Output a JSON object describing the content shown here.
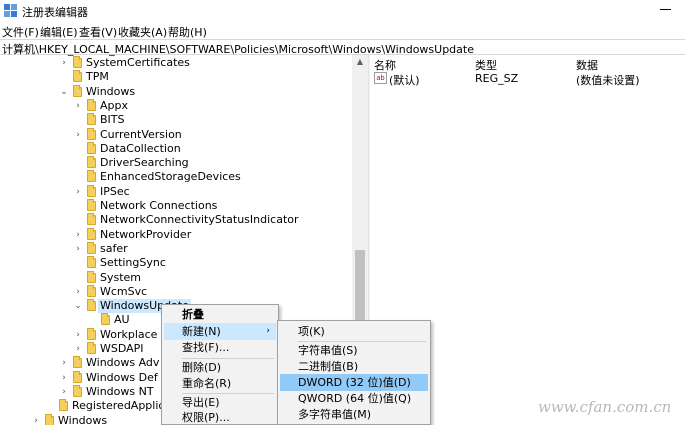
{
  "window": {
    "title": "注册表编辑器",
    "app_icon": "regedit-icon"
  },
  "menu": [
    "文件(F)",
    "编辑(E)",
    "查看(V)",
    "收藏夹(A)",
    "帮助(H)"
  ],
  "address": "计算机\\HKEY_LOCAL_MACHINE\\SOFTWARE\\Policies\\Microsoft\\Windows\\WindowsUpdate",
  "tree": [
    {
      "label": "SystemCertificates",
      "arrow": "›"
    },
    {
      "label": "TPM",
      "arrow": ""
    },
    {
      "label": "Windows",
      "arrow": "⌄"
    },
    {
      "label": "Appx",
      "arrow": "›"
    },
    {
      "label": "BITS",
      "arrow": ""
    },
    {
      "label": "CurrentVersion",
      "arrow": "›"
    },
    {
      "label": "DataCollection",
      "arrow": ""
    },
    {
      "label": "DriverSearching",
      "arrow": ""
    },
    {
      "label": "EnhancedStorageDevices",
      "arrow": ""
    },
    {
      "label": "IPSec",
      "arrow": "›"
    },
    {
      "label": "Network Connections",
      "arrow": ""
    },
    {
      "label": "NetworkConnectivityStatusIndicator",
      "arrow": ""
    },
    {
      "label": "NetworkProvider",
      "arrow": "›"
    },
    {
      "label": "safer",
      "arrow": "›"
    },
    {
      "label": "SettingSync",
      "arrow": ""
    },
    {
      "label": "System",
      "arrow": ""
    },
    {
      "label": "WcmSvc",
      "arrow": "›"
    },
    {
      "label": "WindowsUpdate",
      "arrow": "⌄",
      "selected": true
    },
    {
      "label": "AU",
      "arrow": ""
    },
    {
      "label": "Workplace",
      "arrow": "›"
    },
    {
      "label": "WSDAPI",
      "arrow": "›"
    },
    {
      "label": "Windows Adv",
      "arrow": "›"
    },
    {
      "label": "Windows Def",
      "arrow": "›"
    },
    {
      "label": "Windows NT",
      "arrow": "›"
    },
    {
      "label": "RegisteredApplicat",
      "arrow": ""
    },
    {
      "label": "Windows",
      "arrow": "›"
    }
  ],
  "values": {
    "columns": [
      "名称",
      "类型",
      "数据"
    ],
    "rows": [
      {
        "name": "(默认)",
        "type": "REG_SZ",
        "data": "(数值未设置)",
        "icon": "ab-string-icon",
        "icon_text": "ab"
      }
    ]
  },
  "context_menu": {
    "items": [
      {
        "label": "折叠",
        "bold": true
      },
      {
        "label": "新建(N)",
        "has_sub": true,
        "active": true
      },
      {
        "label": "查找(F)..."
      },
      {
        "label": "删除(D)"
      },
      {
        "label": "重命名(R)"
      },
      {
        "label": "导出(E)"
      },
      {
        "label": "权限(P)..."
      }
    ]
  },
  "submenu": {
    "items": [
      {
        "label": "项(K)"
      },
      {
        "label": "字符串值(S)"
      },
      {
        "label": "二进制值(B)"
      },
      {
        "label": "DWORD (32 位)值(D)",
        "highlighted": true
      },
      {
        "label": "QWORD (64 位)值(Q)"
      },
      {
        "label": "多字符串值(M)"
      }
    ]
  },
  "watermark": "www.cfan.com.cn",
  "colors": {
    "selection": "#cce8ff",
    "menu_highlight": "#91c9f7",
    "folder": "#f4cf5c"
  }
}
